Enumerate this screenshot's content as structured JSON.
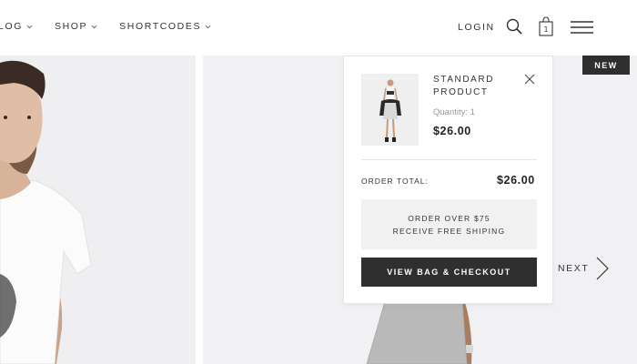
{
  "nav": {
    "items": [
      {
        "label": "LOG",
        "icon": "chevron-down-icon"
      },
      {
        "label": "SHOP",
        "icon": "chevron-down-icon"
      },
      {
        "label": "SHORTCODES",
        "icon": "chevron-down-icon"
      }
    ]
  },
  "header": {
    "login_label": "LOGIN",
    "search_icon": "search-icon",
    "bag_icon": "shopping-bag-icon",
    "bag_count": "1",
    "menu_icon": "hamburger-menu-icon"
  },
  "products": {
    "badge": "NEW",
    "next_label": "NEXT"
  },
  "cart": {
    "item": {
      "name": "STANDARD PRODUCT",
      "quantity": "Quantity: 1",
      "price": "$26.00"
    },
    "total_label": "ORDER TOTAL:",
    "total_value": "$26.00",
    "shipping_line1": "ORDER OVER $75",
    "shipping_line2": "RECEIVE FREE SHIPING",
    "checkout_label": "VIEW BAG & CHECKOUT"
  },
  "colors": {
    "dark": "#2f2f2f",
    "tile_bg": "#f1f1f3",
    "muted_text": "#999999"
  }
}
